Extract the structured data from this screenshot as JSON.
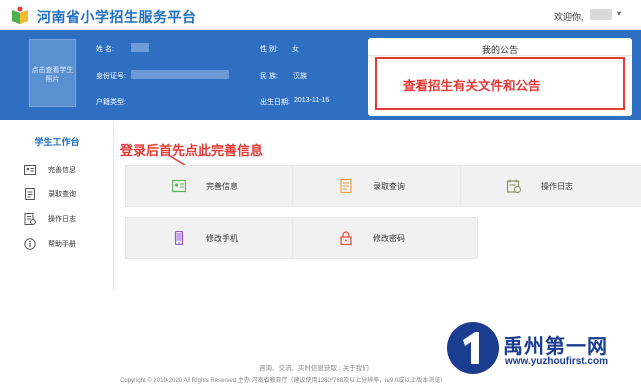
{
  "header": {
    "site_title": "河南省小学招生服务平台",
    "welcome": "欢迎你,"
  },
  "profile": {
    "photo_hint": "点击查看学生照片",
    "name_label": "姓    名:",
    "id_label": "身份证号:",
    "hukou_label": "户籍类型:",
    "gender_label": "性    别:",
    "gender_value": "女",
    "ethnicity_label": "民    族:",
    "ethnicity_value": "汉族",
    "birth_label": "出生日期:",
    "birth_value": "2013-11-16"
  },
  "notice": {
    "title": "我的公告",
    "annotation": "查看招生有关文件和公告"
  },
  "sidebar": {
    "heading": "学生工作台",
    "items": [
      {
        "label": "完善信息",
        "icon": "id-card-icon"
      },
      {
        "label": "录取查询",
        "icon": "document-icon"
      },
      {
        "label": "操作日志",
        "icon": "log-icon"
      },
      {
        "label": "帮助手册",
        "icon": "info-icon"
      }
    ]
  },
  "annotation": "登录后首先点此完善信息",
  "tiles": [
    {
      "label": "完善信息",
      "icon": "id-card-icon",
      "color": "#5cb85c"
    },
    {
      "label": "录取查询",
      "icon": "document-icon",
      "color": "#f0a040"
    },
    {
      "label": "操作日志",
      "icon": "calendar-icon",
      "color": "#8a8f5a"
    },
    {
      "label": "修改手机",
      "icon": "phone-icon",
      "color": "#9b59d0"
    },
    {
      "label": "修改密码",
      "icon": "lock-icon",
      "color": "#e74c3c"
    }
  ],
  "footer": {
    "links": [
      "咨询、交流、实时信息获取",
      "关于我们"
    ],
    "copyright": "Copyright © 2019-2020 All Rights Reserved 主办:河南省教育厅（建议使用1280*768及以上分辨率，ie9.0或以上版本浏览）"
  },
  "watermark": {
    "title": "禹州第一网",
    "url": "www.yuzhoufirst.com"
  },
  "colors": {
    "brand_blue": "#2e6fc1",
    "accent_red": "#e53935",
    "title_blue": "#1f6fc2"
  }
}
